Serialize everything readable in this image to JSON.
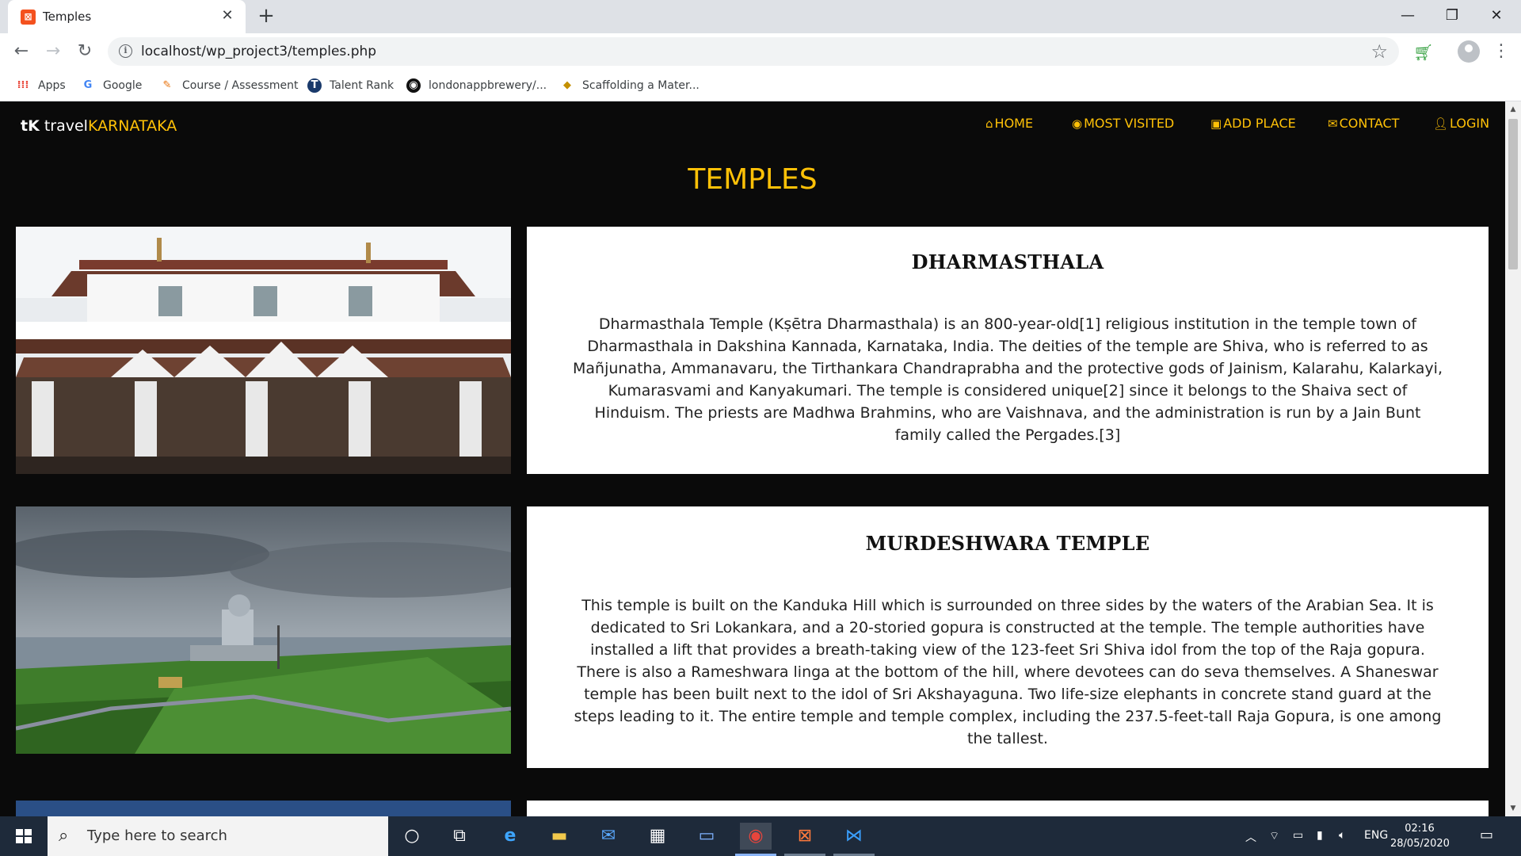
{
  "browser": {
    "tab_title": "Temples",
    "tab_favicon": "xampp-icon",
    "url": "localhost/wp_project3/temples.php",
    "bookmarks": [
      {
        "label": "Apps",
        "icon": "apps-grid-icon"
      },
      {
        "label": "Google",
        "icon": "google-icon"
      },
      {
        "label": "Course / Assessment",
        "icon": "course-icon"
      },
      {
        "label": "Talent Rank",
        "icon": "talent-rank-icon"
      },
      {
        "label": "londonappbrewery/...",
        "icon": "github-icon"
      },
      {
        "label": "Scaffolding a Mater...",
        "icon": "bookmark-icon"
      }
    ]
  },
  "site": {
    "brand_logo": "tK",
    "brand_travel": "travel",
    "brand_karnataka": "KARNATAKA",
    "nav": [
      {
        "label": "HOME",
        "icon": "home-icon"
      },
      {
        "label": "MOST VISITED",
        "icon": "eye-icon"
      },
      {
        "label": "ADD PLACE",
        "icon": "camera-icon"
      },
      {
        "label": "CONTACT",
        "icon": "envelope-icon"
      },
      {
        "label": "LOGIN",
        "icon": "user-icon"
      }
    ],
    "page_title": "TEMPLES",
    "accent_color": "#ffc107",
    "background_color": "#0a0a0a"
  },
  "temples": [
    {
      "name": "DHARMASTHALA",
      "description": "Dharmasthala Temple (Kṣētra Dharmasthala) is an 800-year-old[1] religious institution in the temple town of Dharmasthala in Dakshina Kannada, Karnataka, India. The deities of the temple are Shiva, who is referred to as Mañjunatha, Ammanavaru, the Tirthankara Chandraprabha and the protective gods of Jainism, Kalarahu, Kalarkayi, Kumarasvami and Kanyakumari. The temple is considered unique[2] since it belongs to the Shaiva sect of Hinduism. The priests are Madhwa Brahmins, who are Vaishnava, and the administration is run by a Jain Bunt family called the Pergades.[3]"
    },
    {
      "name": "MURDESHWARA TEMPLE",
      "description": "This temple is built on the Kanduka Hill which is surrounded on three sides by the waters of the Arabian Sea. It is dedicated to Sri Lokankara, and a 20-storied gopura is constructed at the temple. The temple authorities have installed a lift that provides a breath-taking view of the 123-feet Sri Shiva idol from the top of the Raja gopura. There is also a Rameshwara linga at the bottom of the hill, where devotees can do seva themselves. A Shaneswar temple has been built next to the idol of Sri Akshayaguna. Two life-size elephants in concrete stand guard at the steps leading to it. The entire temple and temple complex, including the 237.5-feet-tall Raja Gopura, is one among the tallest."
    }
  ],
  "taskbar": {
    "search_placeholder": "Type here to search",
    "language": "ENG",
    "time": "02:16",
    "date": "28/05/2020"
  }
}
